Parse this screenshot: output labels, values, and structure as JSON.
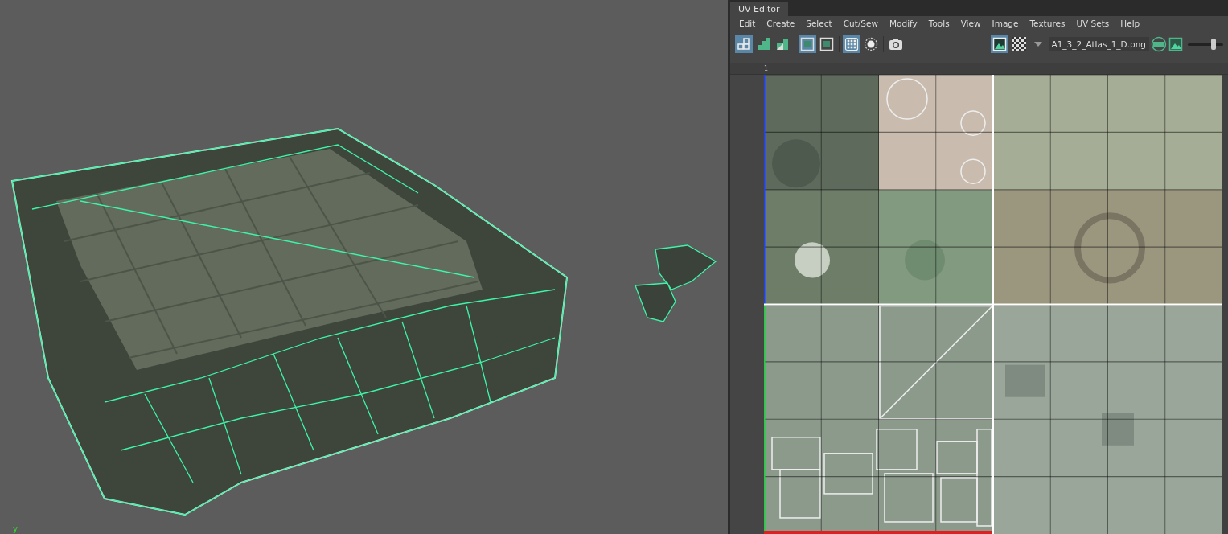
{
  "uv_editor": {
    "title": "UV Editor",
    "menu": [
      "Edit",
      "Create",
      "Select",
      "Cut/Sew",
      "Modify",
      "Tools",
      "View",
      "Image",
      "Textures",
      "UV Sets",
      "Help"
    ],
    "toolbar": [
      {
        "kind": "grid",
        "on": true
      },
      {
        "kind": "stairs",
        "on": false
      },
      {
        "kind": "half",
        "on": false
      },
      {
        "kind": "frame",
        "on": true
      },
      {
        "kind": "frame",
        "on": false
      },
      {
        "kind": "dots",
        "on": true
      },
      {
        "kind": "circle",
        "on": false
      },
      {
        "kind": "camera",
        "on": false
      }
    ],
    "image_tools": [
      {
        "kind": "image",
        "on": true
      },
      {
        "kind": "checker",
        "on": false
      }
    ],
    "texture_name": "A1_3_2_Atlas_1_D.png",
    "exposure": {
      "level": 0.72
    },
    "ruler_label": "1"
  },
  "viewport": {
    "axis_label": "y"
  }
}
